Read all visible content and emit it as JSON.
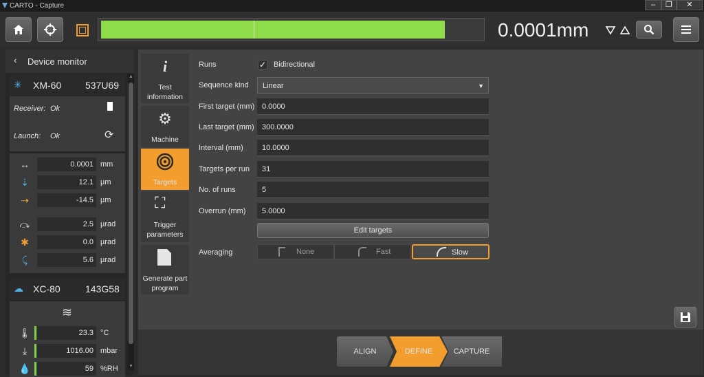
{
  "window": {
    "title": "CARTO - Capture",
    "minimize": "–",
    "maximize": "❐",
    "close": "✕"
  },
  "toolbar": {
    "readout": "0.0001mm",
    "progress": 0.9,
    "marker": 0.4
  },
  "sidebar": {
    "title": "Device monitor",
    "xm": {
      "name": "XM-60",
      "serial": "537U69",
      "receiver_label": "Receiver:",
      "receiver_value": "Ok",
      "launch_label": "Launch:",
      "launch_value": "Ok",
      "rows": [
        {
          "value": "0.0001",
          "unit": "mm"
        },
        {
          "value": "12.1",
          "unit": "µm"
        },
        {
          "value": "-14.5",
          "unit": "µm"
        },
        {
          "value": "2.5",
          "unit": "µrad"
        },
        {
          "value": "0.0",
          "unit": "µrad"
        },
        {
          "value": "5.6",
          "unit": "µrad"
        }
      ]
    },
    "xc": {
      "name": "XC-80",
      "serial": "143G58",
      "rows": [
        {
          "value": "23.3",
          "unit": "°C"
        },
        {
          "value": "1016.00",
          "unit": "mbar"
        },
        {
          "value": "59",
          "unit": "%RH"
        }
      ]
    }
  },
  "nav": {
    "test_info": "Test information",
    "machine": "Machine",
    "targets": "Targets",
    "trigger": "Trigger parameters",
    "generate": "Generate part program"
  },
  "form": {
    "runs_label": "Runs",
    "bidirectional": "Bidirectional",
    "sequence_label": "Sequence kind",
    "sequence_value": "Linear",
    "first_label": "First target (mm)",
    "first_value": "0.0000",
    "last_label": "Last target (mm)",
    "last_value": "300.0000",
    "interval_label": "Interval (mm)",
    "interval_value": "10.0000",
    "tpr_label": "Targets per run",
    "tpr_value": "31",
    "runs_count_label": "No. of runs",
    "runs_count_value": "5",
    "overrun_label": "Overrun (mm)",
    "overrun_value": "5.0000",
    "edit_targets": "Edit targets",
    "averaging_label": "Averaging",
    "avg_none": "None",
    "avg_fast": "Fast",
    "avg_slow": "Slow"
  },
  "steps": {
    "align": "ALIGN",
    "define": "DEFINE",
    "capture": "CAPTURE"
  },
  "colors": {
    "accent": "#f29d2e",
    "progress": "#8fdc4b",
    "status_green": "#7fd14a"
  }
}
